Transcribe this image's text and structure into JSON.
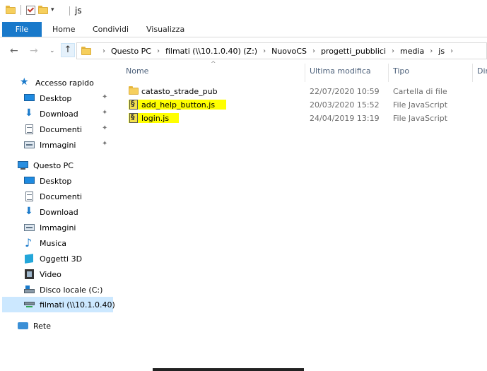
{
  "window": {
    "title": "js"
  },
  "ribbon": {
    "tabs": [
      "File",
      "Home",
      "Condividi",
      "Visualizza"
    ]
  },
  "address": {
    "breadcrumbs": [
      "Questo PC",
      "filmati (\\\\10.1.0.40) (Z:)",
      "NuovoCS",
      "progetti_pubblici",
      "media",
      "js"
    ]
  },
  "sidebar": {
    "items": [
      {
        "label": "Accesso rapido",
        "icon": "star-icon"
      },
      {
        "label": "Desktop",
        "icon": "desktop-icon",
        "pinned": true
      },
      {
        "label": "Download",
        "icon": "download-icon",
        "pinned": true
      },
      {
        "label": "Documenti",
        "icon": "documents-icon",
        "pinned": true
      },
      {
        "label": "Immagini",
        "icon": "images-icon",
        "pinned": true
      },
      {
        "label": "Questo PC",
        "icon": "pc-icon"
      },
      {
        "label": "Desktop",
        "icon": "desktop-icon"
      },
      {
        "label": "Documenti",
        "icon": "documents-icon"
      },
      {
        "label": "Download",
        "icon": "download-icon"
      },
      {
        "label": "Immagini",
        "icon": "images-icon"
      },
      {
        "label": "Musica",
        "icon": "music-icon"
      },
      {
        "label": "Oggetti 3D",
        "icon": "3d-objects-icon"
      },
      {
        "label": "Video",
        "icon": "video-icon"
      },
      {
        "label": "Disco locale (C:)",
        "icon": "local-disk-icon"
      },
      {
        "label": "filmati (\\\\10.1.0.40)",
        "icon": "network-drive-icon",
        "selected": true
      },
      {
        "label": "Rete",
        "icon": "network-icon"
      }
    ],
    "pin_glyph": "📌"
  },
  "filelist": {
    "columns": [
      "Nome",
      "Ultima modifica",
      "Tipo",
      "Dir"
    ],
    "rows": [
      {
        "name": "catasto_strade_pub",
        "modified": "22/07/2020 10:59",
        "type": "Cartella di file",
        "icon": "folder-icon"
      },
      {
        "name": "add_help_button.js",
        "modified": "20/03/2020 15:52",
        "type": "File JavaScript",
        "icon": "js-file-icon",
        "highlighted": true
      },
      {
        "name": "login.js",
        "modified": "24/04/2019 13:19",
        "type": "File JavaScript",
        "icon": "js-file-icon",
        "highlighted": true
      }
    ]
  },
  "colors": {
    "accent": "#1979ca",
    "selection": "#cce8ff",
    "highlight": "#ffff00",
    "header_text": "#4c607a"
  }
}
